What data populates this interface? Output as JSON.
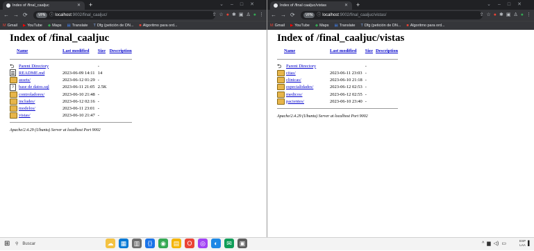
{
  "left": {
    "tab_title": "Index of /final_caaljuc",
    "vpn_badge": "VPN",
    "url_host": "localhost",
    "url_path": ":9002/final_caaljuc/",
    "bookmarks": [
      "Gmail",
      "YouTube",
      "Maps",
      "Translate",
      "Dfg (petición de DN...",
      "Algoritmo para ord..."
    ],
    "heading": "Index of /final_caaljuc",
    "columns": {
      "name": "Name",
      "modified": "Last modified",
      "size": "Size",
      "description": "Description"
    },
    "rows": [
      {
        "icon": "back-icon",
        "name": "Parent Directory",
        "modified": "",
        "size": "-"
      },
      {
        "icon": "text-file-icon",
        "name": "README.md",
        "modified": "2023-06-09 14:11",
        "size": "14"
      },
      {
        "icon": "folder-icon",
        "name": "assets/",
        "modified": "2023-06-12 01:29",
        "size": "-"
      },
      {
        "icon": "unknown-file-icon",
        "name": "base de datos.sql",
        "modified": "2023-06-11 21:05",
        "size": "2.5K"
      },
      {
        "icon": "folder-icon",
        "name": "controladores/",
        "modified": "2023-06-10 21:48",
        "size": "-"
      },
      {
        "icon": "folder-icon",
        "name": "includes/",
        "modified": "2023-06-12 02:16",
        "size": "-"
      },
      {
        "icon": "folder-icon",
        "name": "modelos/",
        "modified": "2023-06-11 23:01",
        "size": "-"
      },
      {
        "icon": "folder-icon",
        "name": "vistas/",
        "modified": "2023-06-10 21:47",
        "size": "-"
      }
    ],
    "address": "Apache/2.4.29 (Ubuntu) Server at localhost Port 9002"
  },
  "right": {
    "tab_title": "Index of /final caaljuc/vistas",
    "vpn_badge": "VPN",
    "url_host": "localhost",
    "url_path": ":9002/final_caaljuc/vistas/",
    "bookmarks": [
      "Gmail",
      "YouTube",
      "Maps",
      "Translate",
      "Dfg (petición de DN...",
      "Algoritmo para ord..."
    ],
    "heading": "Index of /final_caaljuc/vistas",
    "columns": {
      "name": "Name",
      "modified": "Last modified",
      "size": "Size",
      "description": "Description"
    },
    "rows": [
      {
        "icon": "back-icon",
        "name": "Parent Directory",
        "modified": "",
        "size": "-"
      },
      {
        "icon": "folder-icon",
        "name": "citas/",
        "modified": "2023-06-11 23:03",
        "size": "-"
      },
      {
        "icon": "folder-icon",
        "name": "clinicas/",
        "modified": "2023-06-10 21:18",
        "size": "-"
      },
      {
        "icon": "folder-icon",
        "name": "especialidades/",
        "modified": "2023-06-12 02:53",
        "size": "-"
      },
      {
        "icon": "folder-icon",
        "name": "medicos/",
        "modified": "2023-06-12 02:55",
        "size": "-"
      },
      {
        "icon": "folder-icon",
        "name": "pacientes/",
        "modified": "2023-06-10 23:40",
        "size": "-"
      }
    ],
    "address": "Apache/2.4.29 (Ubuntu) Server at localhost Port 9002"
  },
  "taskbar": {
    "search_placeholder": "Buscar",
    "language": "ESP\nLAA"
  },
  "colors": {
    "link": "#0000cc",
    "tabbar": "#202124",
    "toolbar": "#35363a",
    "folder": "#e7b54a"
  }
}
